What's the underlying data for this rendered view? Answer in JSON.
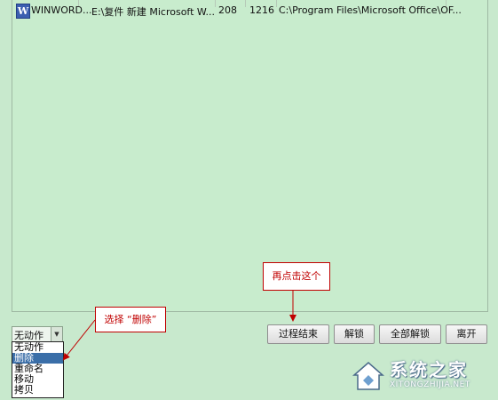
{
  "process_row": {
    "icon": "word-doc-icon",
    "name": "WINWORD...",
    "title": "E:\\复件 新建 Microsoft W...",
    "pid": "208",
    "handle": "1216",
    "path": "C:\\Program Files\\Microsoft Office\\OF..."
  },
  "action_select": {
    "value": "无动作",
    "options": [
      "无动作",
      "删除",
      "重命名",
      "移动",
      "拷贝"
    ],
    "highlighted": "删除"
  },
  "buttons": {
    "kill_process": "过程结束",
    "unlock": "解锁",
    "unlock_all": "全部解锁",
    "exit": "离开"
  },
  "callouts": {
    "select_delete": "选择 “删除”",
    "click_again": "再点击这个"
  },
  "watermark": {
    "name": "系统之家",
    "url": "XITONGZHIJIA.NET"
  },
  "colors": {
    "background": "#c8e9cd",
    "callout_red": "#c00000",
    "selection_blue": "#3a6ea8"
  }
}
